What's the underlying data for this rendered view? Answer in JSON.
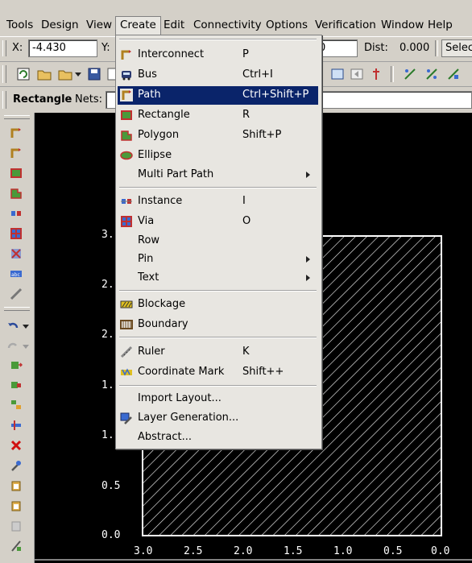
{
  "menubar": {
    "items": [
      "Tools",
      "Design",
      "View",
      "Create",
      "Edit",
      "Connectivity",
      "Options",
      "Verification",
      "Window",
      "Help"
    ],
    "active": "Create"
  },
  "coordbar": {
    "x_label": "X:",
    "x_value": "-4.430",
    "y_label": "Y:",
    "y_value": "0",
    "dist_label": "Dist:",
    "dist_value": "0.000",
    "select_value": "Selec"
  },
  "cmdbar": {
    "mode": "Rectangle",
    "nets_label": "Nets:"
  },
  "create_menu": {
    "groups": [
      [
        {
          "label": "Interconnect",
          "shortcut": "P",
          "icon": "interconnect-icon"
        },
        {
          "label": "Bus",
          "shortcut": "Ctrl+I",
          "icon": "bus-icon"
        },
        {
          "label": "Path",
          "shortcut": "Ctrl+Shift+P",
          "icon": "path-icon",
          "highlighted": true
        },
        {
          "label": "Rectangle",
          "shortcut": "R",
          "icon": "rectangle-icon"
        },
        {
          "label": "Polygon",
          "shortcut": "Shift+P",
          "icon": "polygon-icon"
        },
        {
          "label": "Ellipse",
          "shortcut": "",
          "icon": "ellipse-icon"
        },
        {
          "label": "Multi Part Path",
          "shortcut": "",
          "submenu": true
        }
      ],
      [
        {
          "label": "Instance",
          "shortcut": "I",
          "icon": "instance-icon"
        },
        {
          "label": "Via",
          "shortcut": "O",
          "icon": "via-icon"
        },
        {
          "label": "Row",
          "shortcut": ""
        },
        {
          "label": "Pin",
          "shortcut": "",
          "submenu": true
        },
        {
          "label": "Text",
          "shortcut": "",
          "submenu": true
        }
      ],
      [
        {
          "label": "Blockage",
          "shortcut": "",
          "icon": "blockage-icon"
        },
        {
          "label": "Boundary",
          "shortcut": "",
          "icon": "boundary-icon"
        }
      ],
      [
        {
          "label": "Ruler",
          "shortcut": "K",
          "icon": "ruler-icon"
        },
        {
          "label": "Coordinate Mark",
          "shortcut": "Shift++",
          "icon": "coordinate-mark-icon"
        }
      ],
      [
        {
          "label": "Import Layout...",
          "shortcut": ""
        },
        {
          "label": "Layer Generation...",
          "shortcut": "",
          "icon": "layer-generation-icon"
        },
        {
          "label": "Abstract...",
          "shortcut": ""
        }
      ]
    ]
  },
  "canvas": {
    "y_ticks": [
      "3.",
      "2.",
      "2.",
      "1.",
      "1.",
      "0.5",
      "0.0"
    ],
    "x_ticks": [
      "3.0",
      "2.5",
      "2.0",
      "1.5",
      "1.0",
      "0.5",
      "0.0"
    ]
  },
  "colors": {
    "highlight": "#0a246a",
    "canvas_bg": "#000000",
    "shape_hatch": "#ffffff",
    "panel_bg": "#d4d0c8",
    "menu_bg": "#e8e6e1"
  }
}
